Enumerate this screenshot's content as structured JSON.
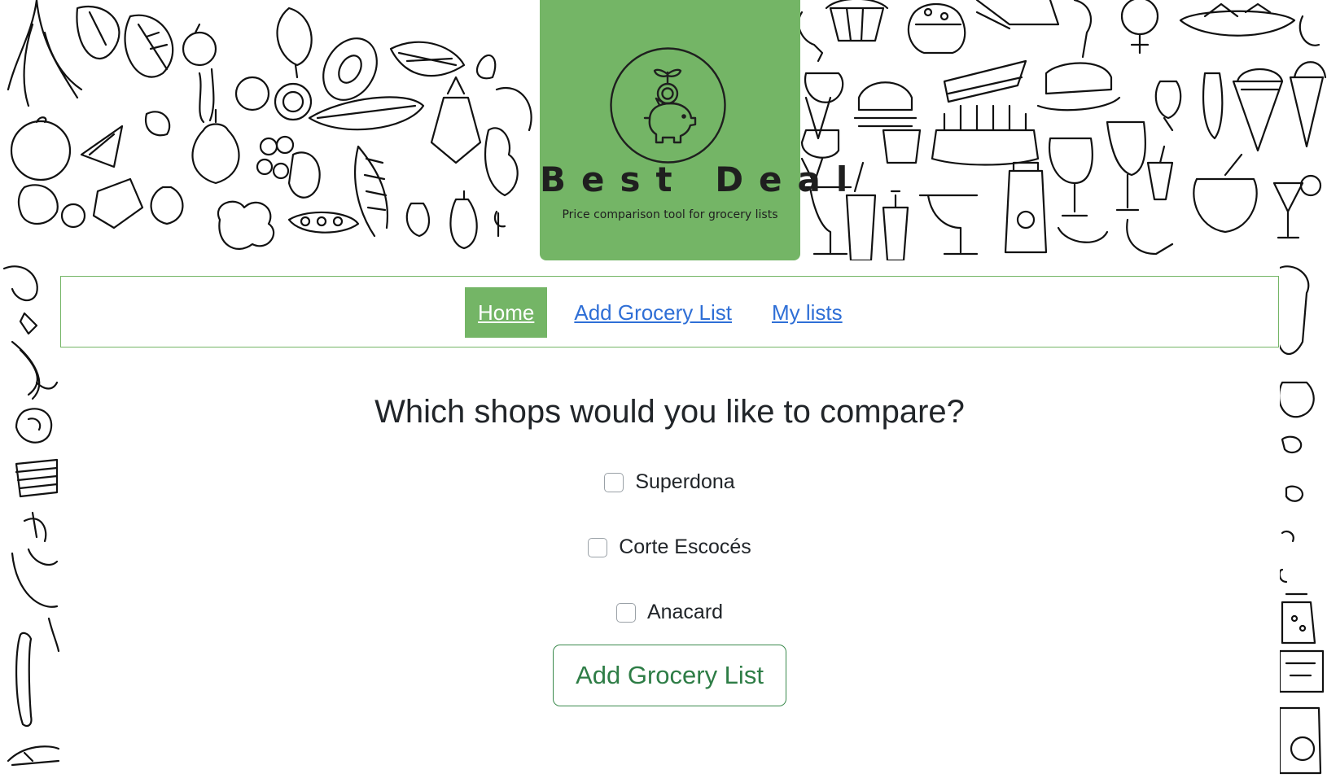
{
  "brand": {
    "title": "Best Deal",
    "subtitle": "Price comparison tool for grocery lists",
    "color": "#74b566"
  },
  "nav": {
    "items": [
      {
        "label": "Home",
        "active": true
      },
      {
        "label": "Add Grocery List",
        "active": false
      },
      {
        "label": "My lists",
        "active": false
      }
    ]
  },
  "main": {
    "question": "Which shops would you like to compare?",
    "shops": [
      {
        "name": "Superdona",
        "checked": false
      },
      {
        "name": "Corte Escocés",
        "checked": false
      },
      {
        "name": "Anacard",
        "checked": false
      }
    ],
    "submit_label": "Add Grocery List"
  },
  "colors": {
    "accent": "#74b566",
    "link": "#2f6fd6",
    "button_outline": "#3b8a4d",
    "text": "#212529"
  },
  "icons": {
    "logo": "piggy-bank-sprout-icon",
    "background": "food-doodle-pattern"
  }
}
